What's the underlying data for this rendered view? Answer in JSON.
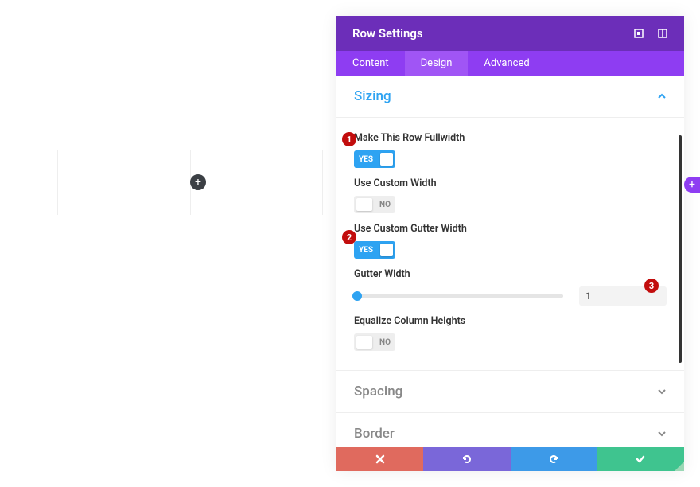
{
  "annotations": {
    "b1": "1",
    "b2": "2",
    "b3": "3"
  },
  "canvas": {
    "add": "+"
  },
  "side_add": "+",
  "panel": {
    "title": "Row Settings",
    "tabs": {
      "content": "Content",
      "design": "Design",
      "advanced": "Advanced"
    },
    "sections": {
      "sizing": {
        "title": "Sizing",
        "fullwidth_label": "Make This Row Fullwidth",
        "fullwidth_value": "YES",
        "custom_width_label": "Use Custom Width",
        "custom_width_value": "NO",
        "custom_gutter_label": "Use Custom Gutter Width",
        "custom_gutter_value": "YES",
        "gutter_label": "Gutter Width",
        "gutter_value": "1",
        "equalize_label": "Equalize Column Heights",
        "equalize_value": "NO"
      },
      "spacing": {
        "title": "Spacing"
      },
      "border": {
        "title": "Border"
      }
    }
  }
}
